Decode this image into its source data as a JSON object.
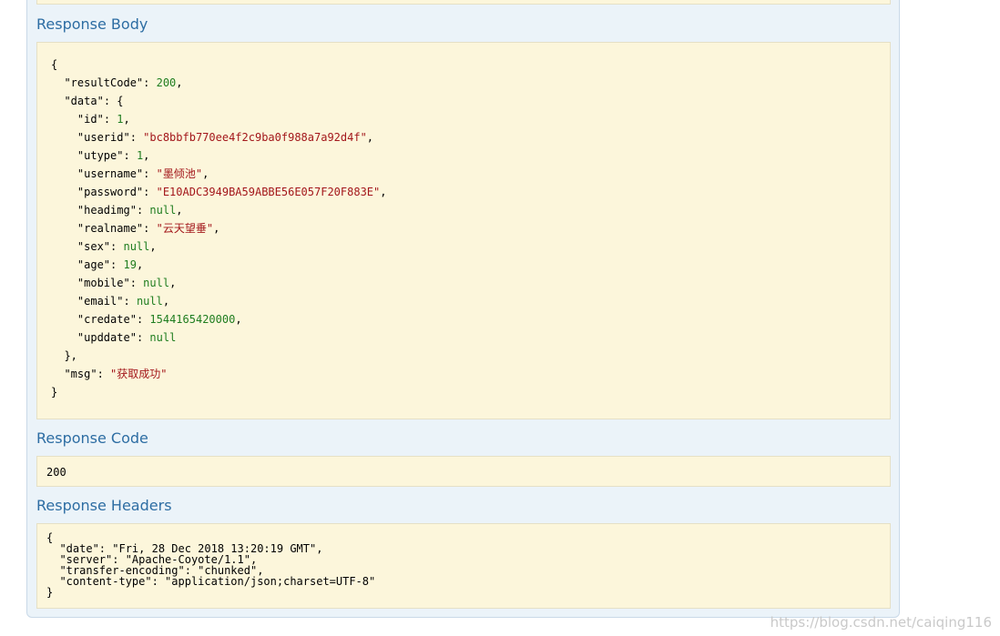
{
  "sections": {
    "body_title": "Response Body",
    "code_title": "Response Code",
    "headers_title": "Response Headers"
  },
  "response_body": {
    "open_brace": "{",
    "resultCode_key": "\"resultCode\"",
    "resultCode_val": "200",
    "data_key": "\"data\"",
    "data_open": "{",
    "id_key": "\"id\"",
    "id_val": "1",
    "userid_key": "\"userid\"",
    "userid_val": "\"bc8bbfb770ee4f2c9ba0f988a7a92d4f\"",
    "utype_key": "\"utype\"",
    "utype_val": "1",
    "username_key": "\"username\"",
    "username_val": "\"墨倾池\"",
    "password_key": "\"password\"",
    "password_val": "\"E10ADC3949BA59ABBE56E057F20F883E\"",
    "headimg_key": "\"headimg\"",
    "headimg_val": "null",
    "realname_key": "\"realname\"",
    "realname_val": "\"云天望垂\"",
    "sex_key": "\"sex\"",
    "sex_val": "null",
    "age_key": "\"age\"",
    "age_val": "19",
    "mobile_key": "\"mobile\"",
    "mobile_val": "null",
    "email_key": "\"email\"",
    "email_val": "null",
    "credate_key": "\"credate\"",
    "credate_val": "1544165420000",
    "upddate_key": "\"upddate\"",
    "upddate_val": "null",
    "data_close": "},",
    "msg_key": "\"msg\"",
    "msg_val": "\"获取成功\"",
    "close_brace": "}"
  },
  "response_code": "200",
  "response_headers": {
    "open": "{",
    "date": "\"date\": \"Fri, 28 Dec 2018 13:20:19 GMT\",",
    "server": "\"server\": \"Apache-Coyote/1.1\",",
    "transfer_encoding": "\"transfer-encoding\": \"chunked\",",
    "content_type": "\"content-type\": \"application/json;charset=UTF-8\"",
    "close": "}"
  },
  "watermark": "https://blog.csdn.net/caiqing116"
}
